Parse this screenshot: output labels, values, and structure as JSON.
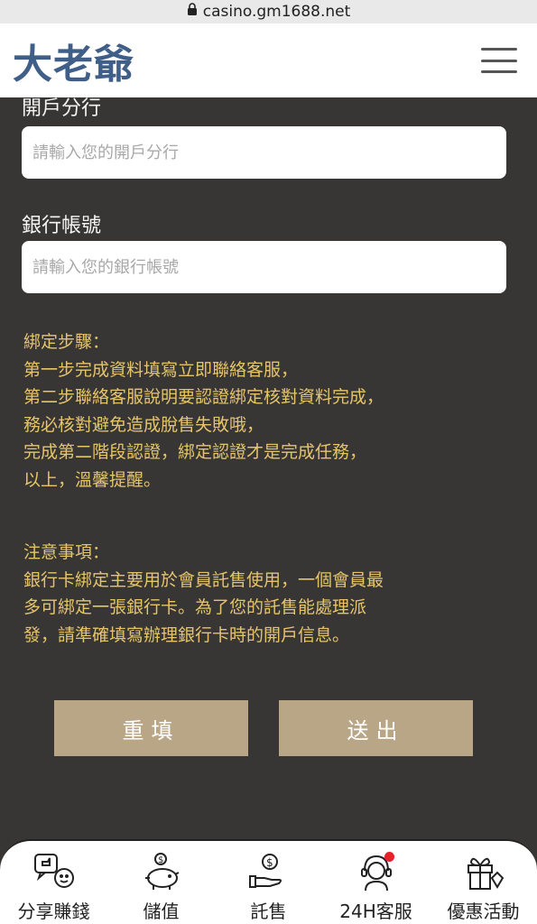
{
  "browser": {
    "url": "casino.gm1688.net"
  },
  "header": {
    "logo_text": "大老爺",
    "menu_icon": "hamburger-menu-icon"
  },
  "form": {
    "branch": {
      "label": "開戶分行",
      "placeholder": "請輸入您的開戶分行",
      "value": ""
    },
    "account": {
      "label": "銀行帳號",
      "placeholder": "請輸入您的銀行帳號",
      "value": ""
    }
  },
  "steps": {
    "title": "綁定步驟：",
    "lines": [
      "第一步完成資料填寫立即聯絡客服，",
      "第二步聯絡客服說明要認證綁定核對資料完成，",
      "務必核對避免造成脫售失敗哦，",
      "完成第二階段認證，綁定認證才是完成任務，",
      "以上，溫馨提醒。"
    ]
  },
  "notice": {
    "title": "注意事項：",
    "lines": [
      "銀行卡綁定主要用於會員託售使用，一個會員最",
      "多可綁定一張銀行卡。為了您的託售能處理派",
      "發，請準確填寫辦理銀行卡時的開戶信息。"
    ]
  },
  "buttons": {
    "reset": "重填",
    "submit": "送出"
  },
  "tabs": [
    {
      "label": "分享賺錢",
      "icon": "share-earn-icon"
    },
    {
      "label": "儲值",
      "icon": "piggy-bank-icon"
    },
    {
      "label": "託售",
      "icon": "hand-coin-icon"
    },
    {
      "label": "24H客服",
      "icon": "support-agent-icon"
    },
    {
      "label": "優惠活動",
      "icon": "gift-icon"
    }
  ],
  "colors": {
    "background": "#373634",
    "accent_text": "#e6c56a",
    "button": "#b9a687",
    "logo": "#3f5f88",
    "badge": "#e8202a"
  }
}
